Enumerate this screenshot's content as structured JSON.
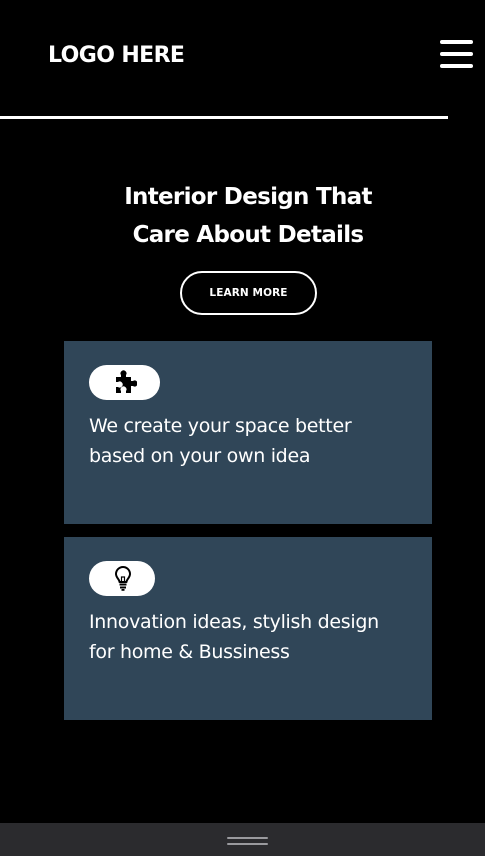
{
  "header": {
    "logo_text": "LOGO HERE",
    "menu_icon": "hamburger-menu-icon"
  },
  "hero": {
    "title_line1": "Interior Design That",
    "title_line2": "Care About Details",
    "cta_label": "LEARN MORE"
  },
  "cards": [
    {
      "icon": "puzzle-piece-icon",
      "text_line1": "We create your space better",
      "text_line2": "based on your own idea"
    },
    {
      "icon": "lightbulb-icon",
      "text_line1": "Innovation ideas, stylish design",
      "text_line2": "for home & Bussiness"
    }
  ],
  "bottom_bar": {
    "handle_icon": "drag-handle-icon"
  },
  "colors": {
    "background": "#000000",
    "card_background": "#304658",
    "text": "#ffffff",
    "bottom_bar": "#2b2b2e"
  }
}
